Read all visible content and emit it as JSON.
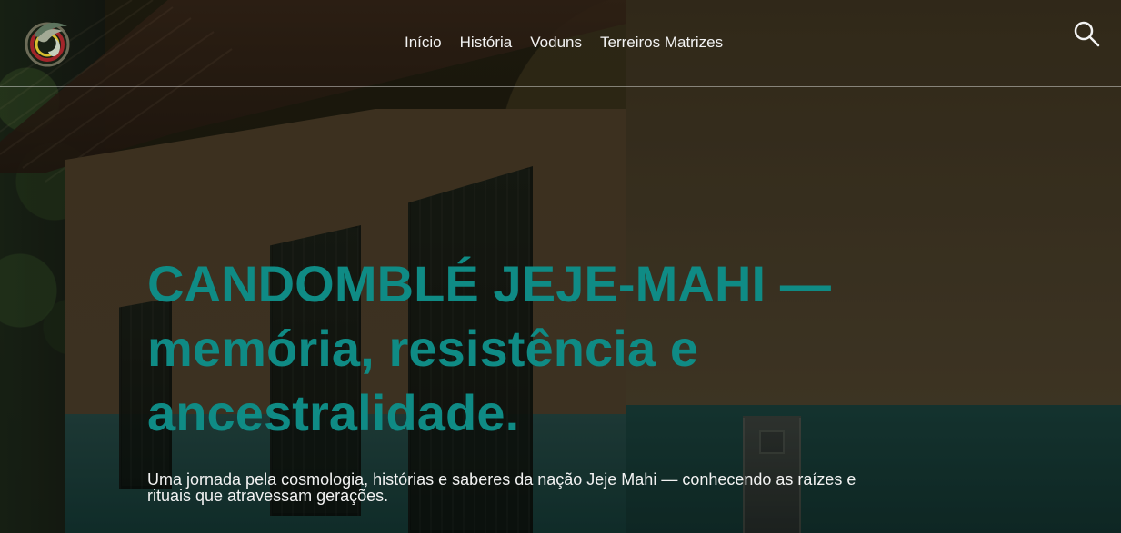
{
  "header": {
    "nav_items": [
      {
        "label": "Início"
      },
      {
        "label": "História"
      },
      {
        "label": "Voduns"
      },
      {
        "label": "Terreiros Matrizes"
      }
    ],
    "search_icon": "search-icon",
    "logo_icon": "brand-logo-icon"
  },
  "hero": {
    "title": "CANDOMBLÉ JEJE-MAHI — memória, resistência e ancestralidade.",
    "subtitle": "Uma jornada pela cosmologia, histórias e saberes da nação Jeje Mahi — conhecendo as raízes e rituais que atravessam gerações."
  },
  "colors": {
    "accent": "#0f8b85",
    "nav_text": "#f3f3f3",
    "subtitle_text": "#f2f2f2"
  }
}
